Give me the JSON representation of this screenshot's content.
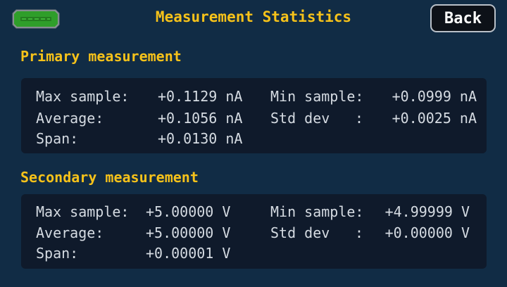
{
  "header": {
    "title": "Measurement Statistics",
    "back_label": "Back",
    "battery_icon": "battery-icon"
  },
  "primary": {
    "title": "Primary measurement",
    "max_label": "Max sample:",
    "max_value": "+0.1129 nA",
    "min_label": "Min sample:",
    "min_value": "+0.0999 nA",
    "avg_label": "Average:",
    "avg_value": "+0.1056 nA",
    "std_label": "Std dev",
    "std_colon": ":",
    "std_value": "+0.0025 nA",
    "span_label": "Span:",
    "span_value": "+0.0130 nA"
  },
  "secondary": {
    "title": "Secondary measurement",
    "max_label": "Max sample:",
    "max_value": "+5.00000 V",
    "min_label": "Min sample:",
    "min_value": "+4.99999 V",
    "avg_label": "Average:",
    "avg_value": "+5.00000 V",
    "std_label": "Std dev",
    "std_colon": ":",
    "std_value": "+0.00000 V",
    "span_label": "Span:",
    "span_value": "+0.00001 V"
  },
  "colors": {
    "background": "#112c45",
    "panel": "#0f1a2b",
    "accent": "#f6c21a",
    "text": "#d5dbe2",
    "battery_fill": "#2f9e2a"
  }
}
